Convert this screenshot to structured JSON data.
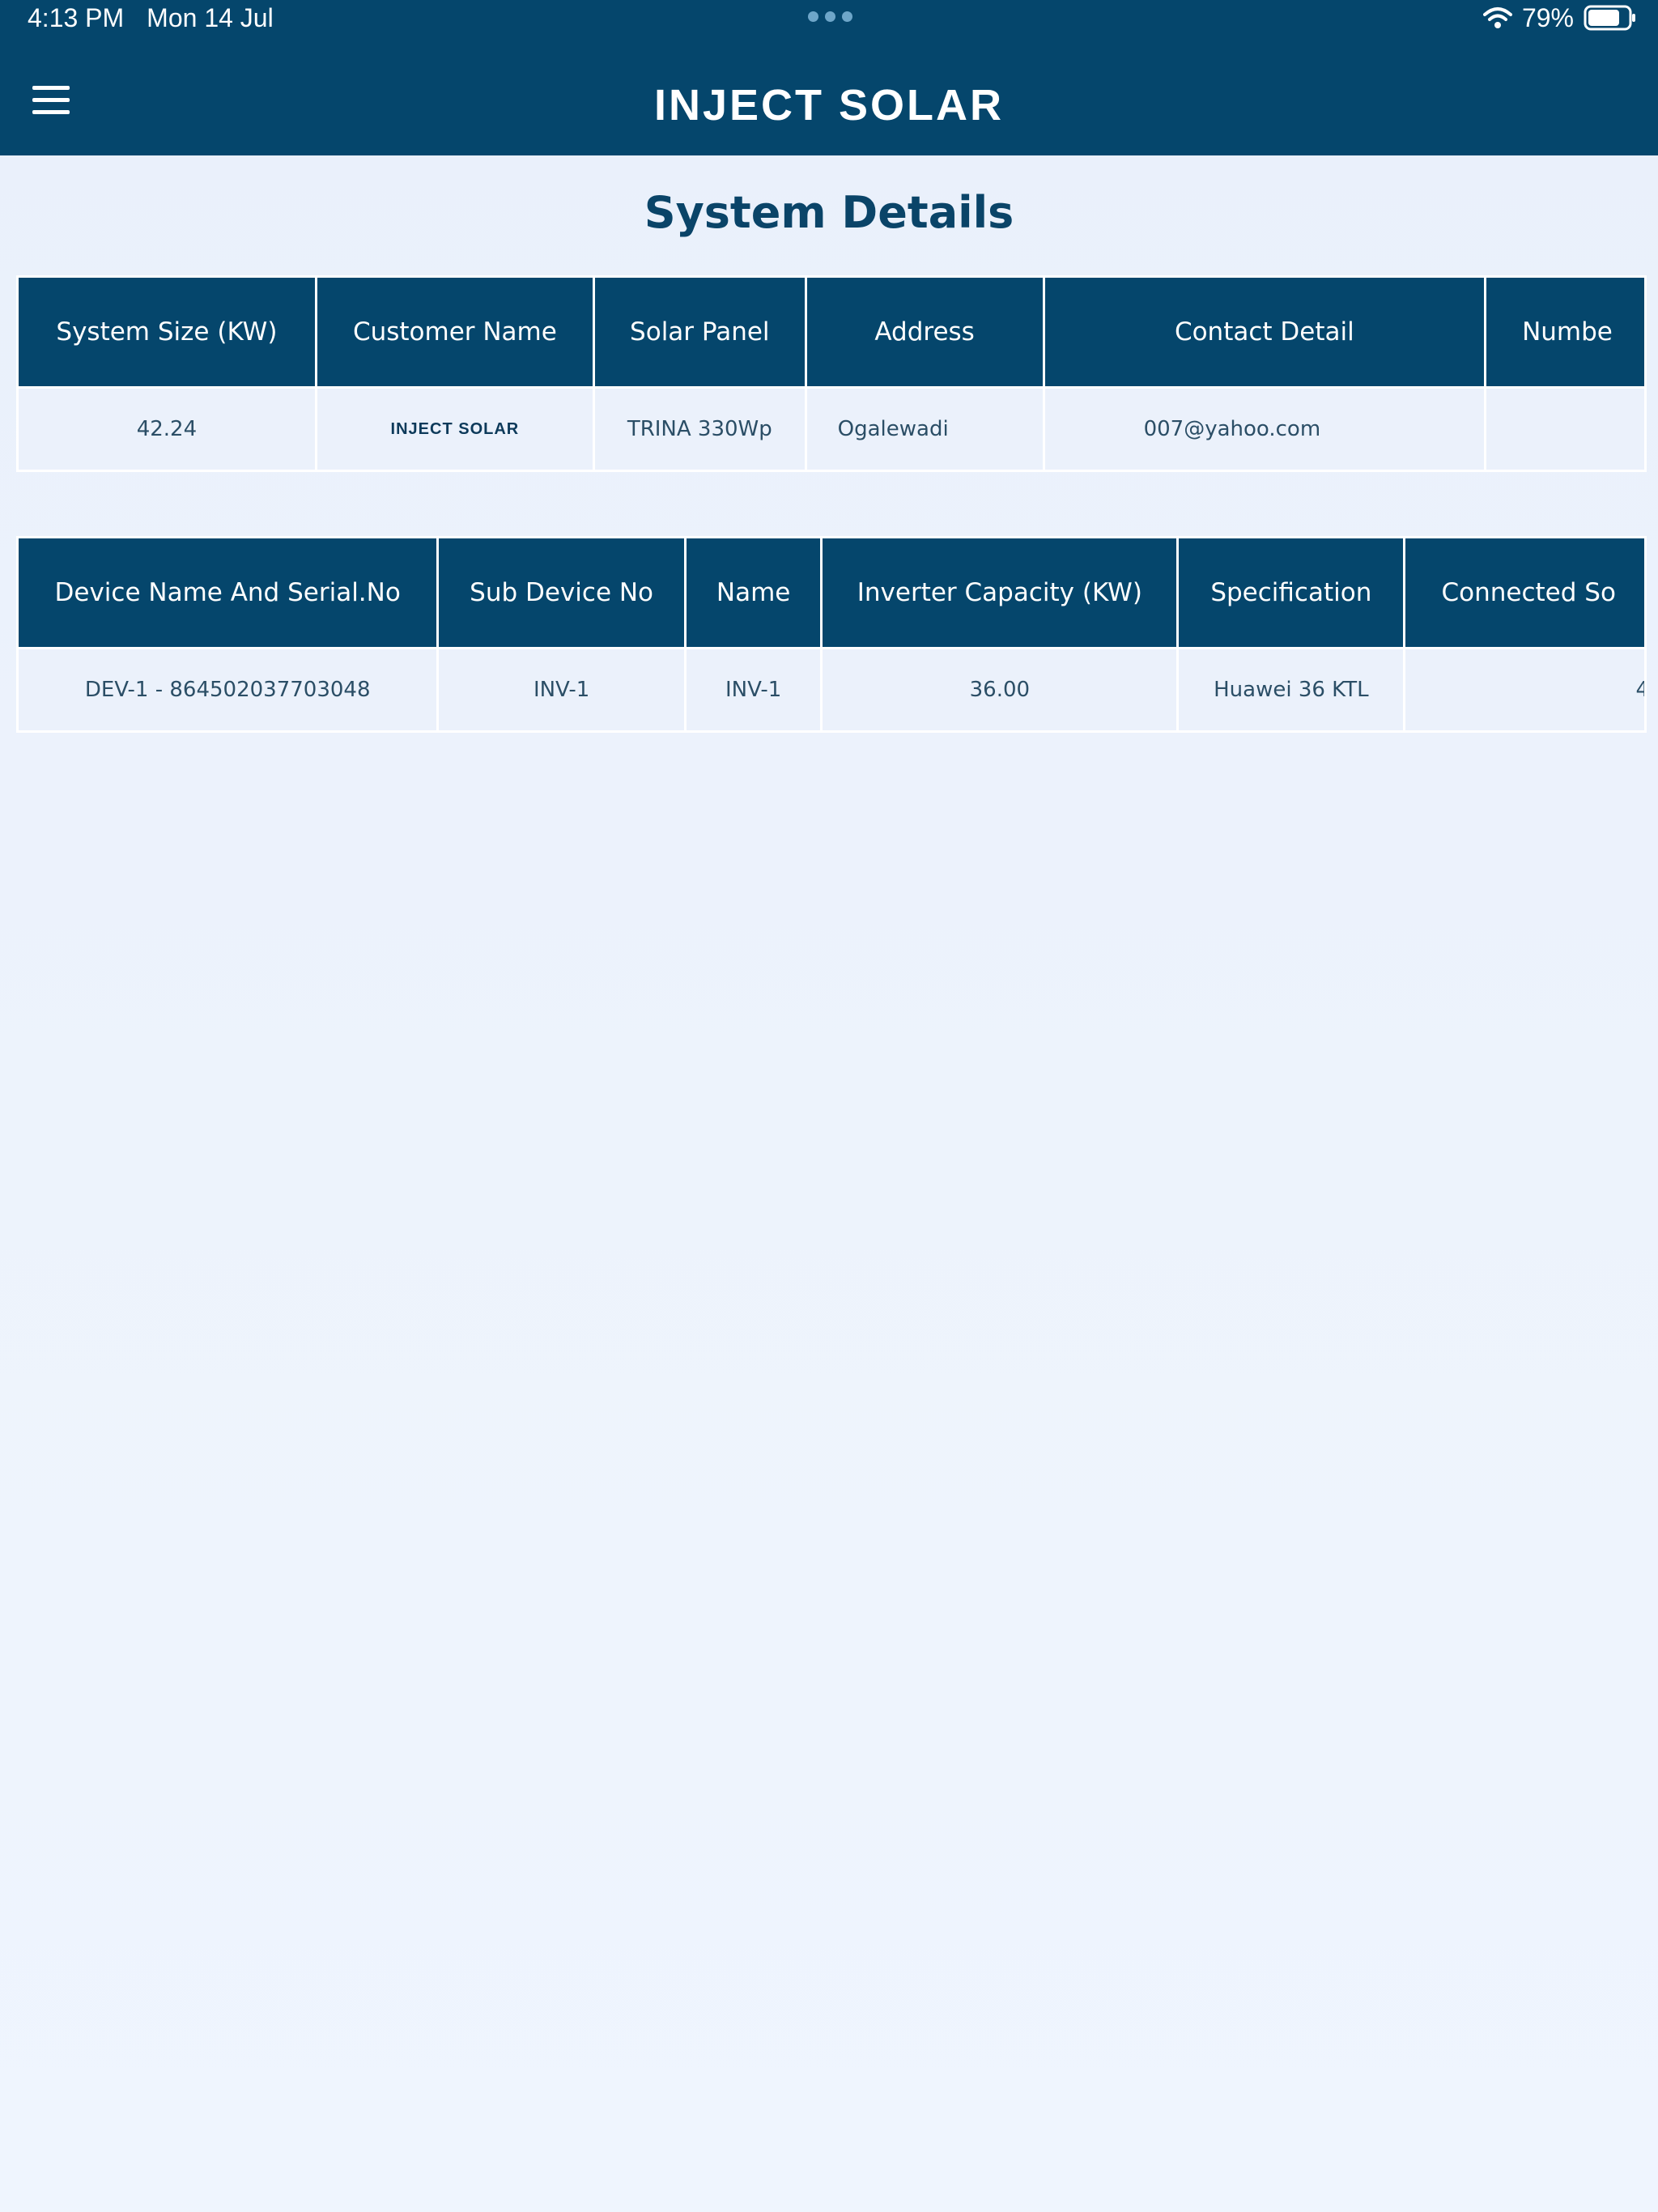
{
  "status_bar": {
    "time": "4:13 PM",
    "date": "Mon 14 Jul",
    "battery": "79%",
    "icons": [
      "more-dots-icon",
      "wifi-icon",
      "battery-icon"
    ]
  },
  "nav": {
    "menu_icon": "hamburger-menu-icon",
    "title": "INJECT SOLAR"
  },
  "page": {
    "title": "System Details"
  },
  "system_table": {
    "headers": [
      "System Size (KW)",
      "Customer Name",
      "Solar Panel",
      "Address",
      "Contact Detail",
      "Numbe"
    ],
    "rows": [
      [
        "42.24",
        "INJECT SOLAR",
        "TRINA 330Wp",
        "Ogalewadi",
        "007@yahoo.com",
        ""
      ]
    ]
  },
  "device_table": {
    "headers": [
      "Device Name And Serial.No",
      "Sub Device No",
      "Name",
      "Inverter Capacity (KW)",
      "Specification",
      "Connected So"
    ],
    "rows": [
      [
        "DEV-1 - 864502037703048",
        "INV-1",
        "INV-1",
        "36.00",
        "Huawei 36 KTL",
        "4"
      ]
    ]
  },
  "colors": {
    "primary": "#05466c",
    "title_text": "#0a4468",
    "cell_bg": "#ebf1fb",
    "cell_text": "#2b4e66"
  }
}
